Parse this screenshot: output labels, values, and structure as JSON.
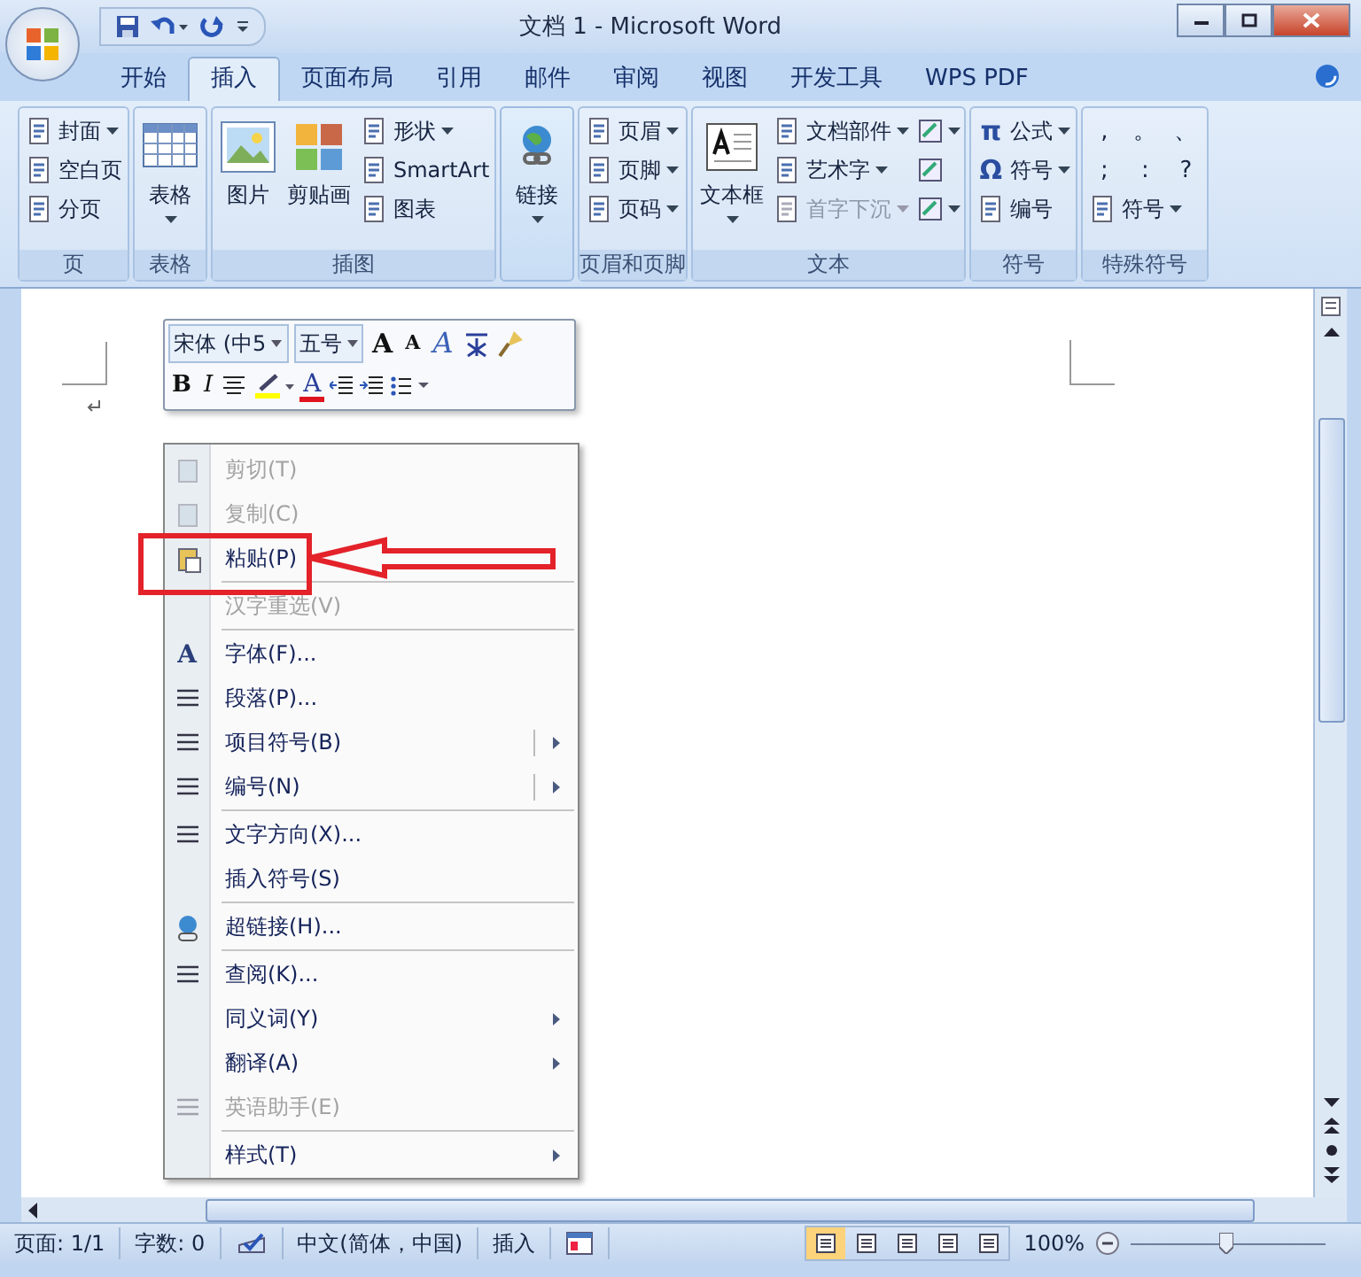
{
  "window": {
    "title": "文档 1 - Microsoft Word"
  },
  "tabs": [
    {
      "label": "开始",
      "selected": false
    },
    {
      "label": "插入",
      "selected": true
    },
    {
      "label": "页面布局",
      "selected": false
    },
    {
      "label": "引用",
      "selected": false
    },
    {
      "label": "邮件",
      "selected": false
    },
    {
      "label": "审阅",
      "selected": false
    },
    {
      "label": "视图",
      "selected": false
    },
    {
      "label": "开发工具",
      "selected": false
    },
    {
      "label": "WPS PDF",
      "selected": false
    }
  ],
  "ribbon": [
    {
      "label": "页",
      "items": [
        {
          "kind": "small",
          "label": "封面",
          "dropdown": true
        },
        {
          "kind": "small",
          "label": "空白页",
          "dropdown": false
        },
        {
          "kind": "small",
          "label": "分页",
          "dropdown": false
        }
      ]
    },
    {
      "label": "表格",
      "items": [
        {
          "kind": "large",
          "label": "表格",
          "dropdown": true
        }
      ]
    },
    {
      "label": "插图",
      "items": [
        {
          "kind": "large",
          "label": "图片",
          "dropdown": false
        },
        {
          "kind": "large",
          "label": "剪贴画",
          "dropdown": false
        },
        {
          "kind": "small",
          "label": "形状",
          "dropdown": true
        },
        {
          "kind": "small",
          "label": "SmartArt",
          "dropdown": false
        },
        {
          "kind": "small",
          "label": "图表",
          "dropdown": false
        }
      ]
    },
    {
      "items": [
        {
          "kind": "large",
          "label": "链接",
          "dropdown": true
        }
      ]
    },
    {
      "label": "页眉和页脚",
      "items": [
        {
          "kind": "small",
          "label": "页眉",
          "dropdown": true
        },
        {
          "kind": "small",
          "label": "页脚",
          "dropdown": true
        },
        {
          "kind": "small",
          "label": "页码",
          "dropdown": true
        }
      ]
    },
    {
      "label": "文本",
      "items": [
        {
          "kind": "large",
          "label": "文本框",
          "dropdown": true
        },
        {
          "kind": "small",
          "label": "文档部件",
          "dropdown": true
        },
        {
          "kind": "small",
          "label": "艺术字",
          "dropdown": true
        },
        {
          "kind": "small",
          "label": "首字下沉",
          "dropdown": true,
          "disabled": true
        },
        {
          "kind": "icon",
          "dropdown": true
        },
        {
          "kind": "icon",
          "dropdown": false
        },
        {
          "kind": "icon",
          "dropdown": true
        }
      ]
    },
    {
      "label": "符号",
      "items": [
        {
          "kind": "small",
          "label": "公式",
          "dropdown": true,
          "glyph": "π"
        },
        {
          "kind": "small",
          "label": "符号",
          "dropdown": true,
          "glyph": "Ω"
        },
        {
          "kind": "small",
          "label": "编号",
          "dropdown": false
        }
      ]
    },
    {
      "label": "特殊符号",
      "items": [
        {
          "kind": "char",
          "label": ","
        },
        {
          "kind": "char",
          "label": "。"
        },
        {
          "kind": "char",
          "label": "、"
        },
        {
          "kind": "char",
          "label": ";"
        },
        {
          "kind": "char",
          "label": ":"
        },
        {
          "kind": "char",
          "label": "?"
        },
        {
          "kind": "small",
          "label": "符号",
          "dropdown": true
        }
      ]
    }
  ],
  "mini_toolbar": {
    "font": "宋体 (中5",
    "size": "五号",
    "row1": [
      {
        "label": "A",
        "kind": "grow"
      },
      {
        "label": "A",
        "kind": "shrink"
      },
      {
        "label": "A",
        "kind": "styles"
      }
    ],
    "row2": [
      {
        "label": "B",
        "kind": "bold"
      },
      {
        "label": "I",
        "kind": "italic"
      }
    ],
    "font_color_label": "A"
  },
  "context_menu": [
    {
      "label": "剪切(T)",
      "disabled": true
    },
    {
      "label": "复制(C)",
      "disabled": true
    },
    {
      "label": "粘贴(P)",
      "disabled": false,
      "highlighted": true
    },
    {
      "label": "汉字重选(V)",
      "disabled": true,
      "separator": true
    },
    {
      "label": "字体(F)...",
      "disabled": false,
      "separator": true,
      "glyph": "A"
    },
    {
      "label": "段落(P)...",
      "disabled": false
    },
    {
      "label": "项目符号(B)",
      "disabled": false,
      "submenu": true,
      "split": true
    },
    {
      "label": "编号(N)",
      "disabled": false,
      "submenu": true,
      "split": true
    },
    {
      "label": "文字方向(X)...",
      "disabled": false,
      "separator": true
    },
    {
      "label": "插入符号(S)",
      "disabled": false
    },
    {
      "label": "超链接(H)...",
      "disabled": false,
      "separator": true
    },
    {
      "label": "查阅(K)...",
      "disabled": false,
      "separator": true
    },
    {
      "label": "同义词(Y)",
      "disabled": false,
      "submenu": true
    },
    {
      "label": "翻译(A)",
      "disabled": false,
      "submenu": true
    },
    {
      "label": "英语助手(E)",
      "disabled": true
    },
    {
      "label": "样式(T)",
      "disabled": false,
      "submenu": true,
      "separator": true
    }
  ],
  "status_bar": {
    "page": "页面: 1/1",
    "words": "字数: 0",
    "language": "中文(简体，中国)",
    "mode": "插入",
    "views": [
      {
        "selected": true
      },
      {
        "selected": false
      },
      {
        "selected": false
      },
      {
        "selected": false
      },
      {
        "selected": false
      }
    ],
    "zoom": "100%"
  }
}
